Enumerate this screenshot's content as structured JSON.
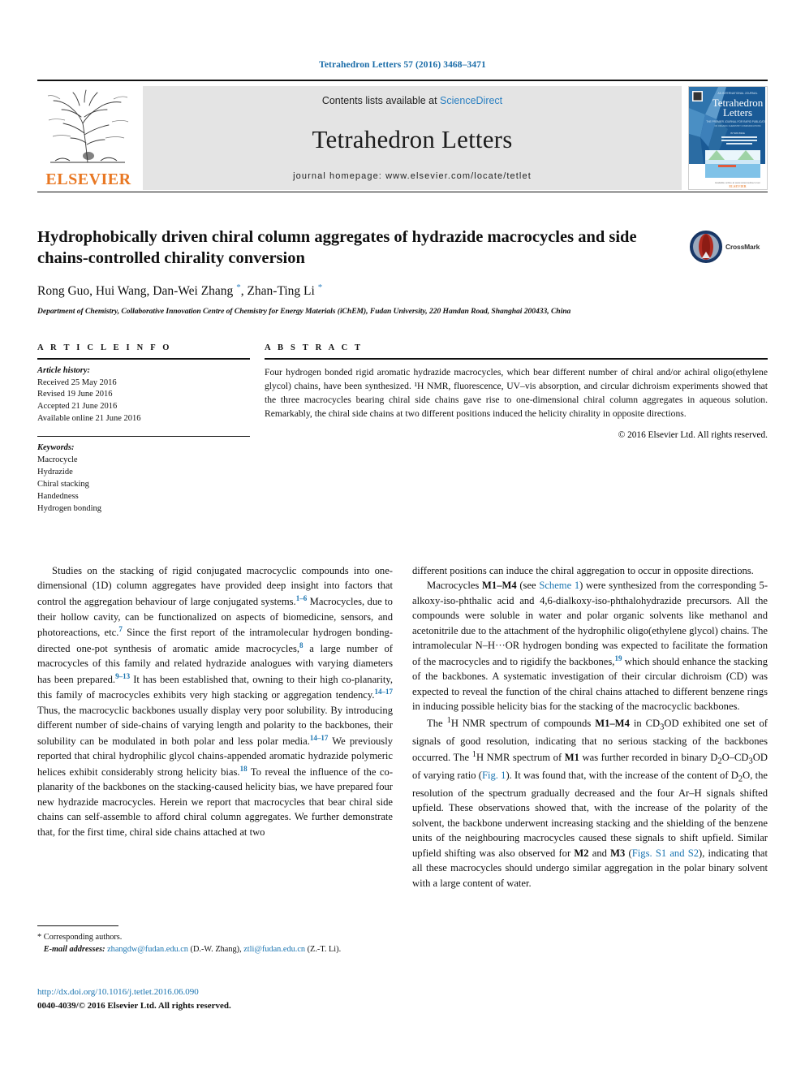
{
  "running_head": "Tetrahedron Letters 57 (2016) 3468–3471",
  "masthead": {
    "publisher_name": "ELSEVIER",
    "contents_prefix": "Contents lists available at ",
    "contents_link": "ScienceDirect",
    "journal_name": "Tetrahedron Letters",
    "homepage_line": "journal homepage: www.elsevier.com/locate/tetlet",
    "cover_title_line1": "Tetrahedron",
    "cover_title_line2": "Letters"
  },
  "article": {
    "title": "Hydrophobically driven chiral column aggregates of hydrazide macrocycles and side chains-controlled chirality conversion",
    "crossmark_label": "CrossMark",
    "authors_html": "Rong Guo, Hui Wang, Dan-Wei Zhang <sup>*</sup>, Zhan-Ting Li <sup>*</sup>",
    "affiliation": "Department of Chemistry, Collaborative Innovation Centre of Chemistry for Energy Materials (iChEM), Fudan University, 220 Handan Road, Shanghai 200433, China"
  },
  "article_info": {
    "heading": "A R T I C L E   I N F O",
    "history_label": "Article history:",
    "history": [
      "Received 25 May 2016",
      "Revised 19 June 2016",
      "Accepted 21 June 2016",
      "Available online 21 June 2016"
    ],
    "keywords_label": "Keywords:",
    "keywords": [
      "Macrocycle",
      "Hydrazide",
      "Chiral stacking",
      "Handedness",
      "Hydrogen bonding"
    ]
  },
  "abstract": {
    "heading": "A B S T R A C T",
    "text": "Four hydrogen bonded rigid aromatic hydrazide macrocycles, which bear different number of chiral and/or achiral oligo(ethylene glycol) chains, have been synthesized. ¹H NMR, fluorescence, UV–vis absorption, and circular dichroism experiments showed that the three macrocycles bearing chiral side chains gave rise to one-dimensional chiral column aggregates in aqueous solution. Remarkably, the chiral side chains at two different positions induced the helicity chirality in opposite directions.",
    "rights": "© 2016 Elsevier Ltd. All rights reserved."
  },
  "body": {
    "left_column": [
      "Studies on the stacking of rigid conjugated macrocyclic compounds into one-dimensional (1D) column aggregates have provided deep insight into factors that control the aggregation behaviour of large conjugated systems.<sup class=\"ref\">1–6</sup> Macrocycles, due to their hollow cavity, can be functionalized on aspects of biomedicine, sensors, and photoreactions, etc.<sup class=\"ref\">7</sup> Since the first report of the intramolecular hydrogen bonding-directed one-pot synthesis of aromatic amide macrocycles,<sup class=\"ref\">8</sup> a large number of macrocycles of this family and related hydrazide analogues with varying diameters has been prepared.<sup class=\"ref\">9–13</sup> It has been established that, owning to their high co-planarity, this family of macrocycles exhibits very high stacking or aggregation tendency.<sup class=\"ref\">14–17</sup> Thus, the macrocyclic backbones usually display very poor solubility. By introducing different number of side-chains of varying length and polarity to the backbones, their solubility can be modulated in both polar and less polar media.<sup class=\"ref\">14–17</sup> We previously reported that chiral hydrophilic glycol chains-appended aromatic hydrazide polymeric helices exhibit considerably strong helicity bias.<sup class=\"ref\">18</sup> To reveal the influence of the co-planarity of the backbones on the stacking-caused helicity bias, we have prepared four new hydrazide macrocycles. Herein we report that macrocycles that bear chiral side chains can self-assemble to afford chiral column aggregates. We further demonstrate that, for the first time, chiral side chains attached at two"
    ],
    "right_column": [
      "different positions can induce the chiral aggregation to occur in opposite directions.",
      "Macrocycles <b>M1–M4</b> (see <span class=\"lnk\">Scheme 1</span>) were synthesized from the corresponding 5-alkoxy-iso-phthalic acid and 4,6-dialkoxy-iso-phthalohydrazide precursors. All the compounds were soluble in water and polar organic solvents like methanol and acetonitrile due to the attachment of the hydrophilic oligo(ethylene glycol) chains. The intramolecular N–H···OR hydrogen bonding was expected to facilitate the formation of the macrocycles and to rigidify the backbones,<sup class=\"ref\">19</sup> which should enhance the stacking of the backbones. A systematic investigation of their circular dichroism (CD) was expected to reveal the function of the chiral chains attached to different benzene rings in inducing possible helicity bias for the stacking of the macrocyclic backbones.",
      "The <sup>1</sup>H NMR spectrum of compounds <b>M1–M4</b> in CD<sub>3</sub>OD exhibited one set of signals of good resolution, indicating that no serious stacking of the backbones occurred. The <sup>1</sup>H NMR spectrum of <b>M1</b> was further recorded in binary D<sub>2</sub>O–CD<sub>3</sub>OD of varying ratio (<span class=\"lnk\">Fig. 1</span>). It was found that, with the increase of the content of D<sub>2</sub>O, the resolution of the spectrum gradually decreased and the four Ar–H signals shifted upfield. These observations showed that, with the increase of the polarity of the solvent, the backbone underwent increasing stacking and the shielding of the benzene units of the neighbouring macrocycles caused these signals to shift upfield. Similar upfield shifting was also observed for <b>M2</b> and <b>M3</b> (<span class=\"lnk\">Figs. S1 and S2</span>), indicating that all these macrocycles should undergo similar aggregation in the polar binary solvent with a large content of water."
    ]
  },
  "footnote": {
    "corresponding": "* Corresponding authors.",
    "email_label": "E-mail addresses:",
    "email1": "zhangdw@fudan.edu.cn",
    "email1_owner": "(D.-W. Zhang)",
    "email2": "ztli@fudan.edu.cn",
    "email2_owner": "(Z.-T. Li)."
  },
  "bottom": {
    "doi": "http://dx.doi.org/10.1016/j.tetlet.2016.06.090",
    "issn_rights": "0040-4039/© 2016 Elsevier Ltd. All rights reserved."
  },
  "colors": {
    "link_blue": "#1a74b0",
    "elsevier_orange": "#E87722",
    "band_gray": "#e4e4e4"
  }
}
